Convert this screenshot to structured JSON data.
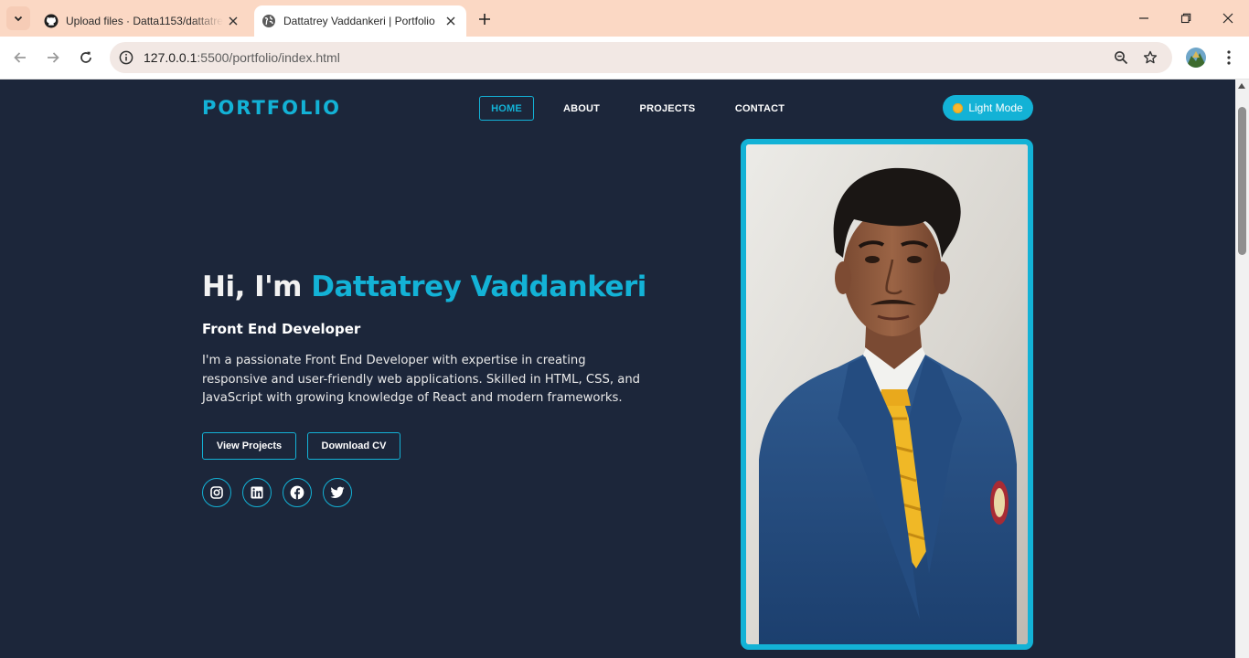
{
  "browser": {
    "tabs": [
      {
        "title": "Upload files · Datta1153/dattatrey",
        "icon": "github-icon",
        "active": false
      },
      {
        "title": "Dattatrey Vaddankeri | Portfolio",
        "icon": "globe-icon",
        "active": true
      }
    ],
    "url_host": "127.0.0.1",
    "url_rest": ":5500/portfolio/index.html"
  },
  "page": {
    "logo": "PORTFOLIO",
    "nav": {
      "home": "HOME",
      "about": "ABOUT",
      "projects": "PROJECTS",
      "contact": "CONTACT"
    },
    "theme_toggle": "Light Mode",
    "hero": {
      "greeting": "Hi, I'm ",
      "name": "Dattatrey Vaddankeri",
      "role": "Front End Developer",
      "description": "I'm a passionate Front End Developer with expertise in creating responsive and user-friendly web applications. Skilled in HTML, CSS, and JavaScript with growing knowledge of React and modern frameworks.",
      "buttons": {
        "projects": "View Projects",
        "cv": "Download CV"
      }
    },
    "social": [
      "instagram-icon",
      "linkedin-icon",
      "facebook-icon",
      "twitter-icon"
    ]
  },
  "colors": {
    "accent": "#13b2d6",
    "background": "#1c263a",
    "tabbar": "#fbd8c4"
  }
}
